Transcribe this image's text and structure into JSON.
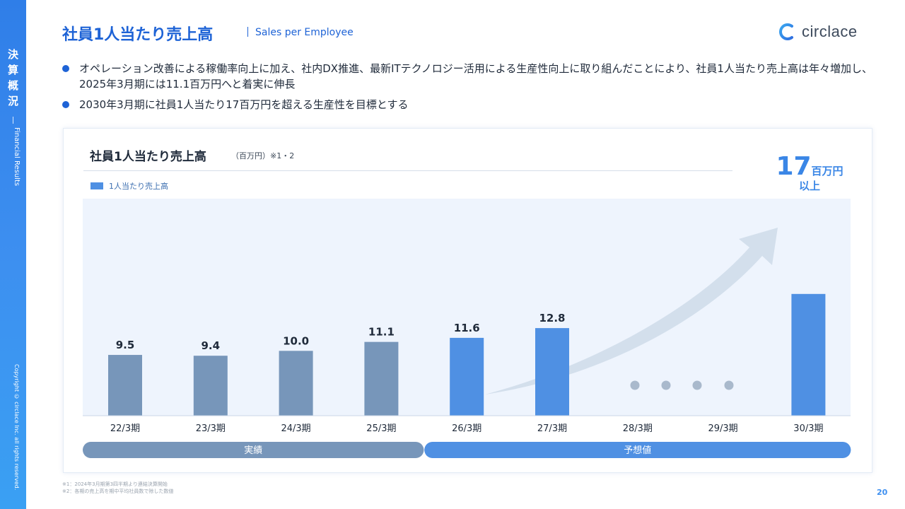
{
  "sidebar": {
    "section_chars": [
      "決",
      "算",
      "概",
      "況"
    ],
    "section_en": "Financial Results",
    "copyright": "Copyright © circlace Inc. all rights reserved."
  },
  "header": {
    "title": "社員1人当たり売上高",
    "subtitle": "Sales per Employee",
    "logo_text": "circlace"
  },
  "bullets": [
    "オペレーション改善による稼働率向上に加え、社内DX推進、最新ITテクノロジー活用による生産性向上に取り組んだことにより、社員1人当たり売上高は年々増加し、2025年3月期には11.1百万円へと着実に伸長",
    "2030年3月期に社員1人当たり17百万円を超える生産性を目標とする"
  ],
  "chart_data": {
    "type": "bar",
    "title": "社員1人当たり売上高",
    "unit": "（百万円）※1・2",
    "legend": "1人当たり売上高",
    "categories": [
      "22/3期",
      "23/3期",
      "24/3期",
      "25/3期",
      "26/3期",
      "27/3期",
      "28/3期",
      "29/3期",
      "30/3期"
    ],
    "series": [
      {
        "name": "1人当たり売上高",
        "values": [
          9.5,
          9.4,
          10.0,
          11.1,
          11.6,
          12.8,
          null,
          null,
          17
        ],
        "labels": [
          "9.5",
          "9.4",
          "10.0",
          "11.1",
          "11.6",
          "12.8",
          "",
          "",
          ""
        ]
      }
    ],
    "kind": [
      "actual",
      "actual",
      "actual",
      "actual",
      "forecast",
      "forecast",
      "none",
      "none",
      "forecast"
    ],
    "target": {
      "value": "17",
      "unit": "百万円",
      "sub": "以上"
    },
    "groups": [
      {
        "label": "実績",
        "from": 0,
        "to": 3
      },
      {
        "label": "予想値",
        "from": 4,
        "to": 8
      }
    ],
    "colors": {
      "actual": "#7796ba",
      "forecast": "#4f90e3",
      "plot_bg": "#eef4fd",
      "arrow": "#d3dfec",
      "dots": "#a9b9cc"
    }
  },
  "footnotes": [
    "※1：2024年3月期第3四半期より連結決算開始",
    "※2：各期の売上高を期中平均社員数で除した数値"
  ],
  "page_number": "20"
}
